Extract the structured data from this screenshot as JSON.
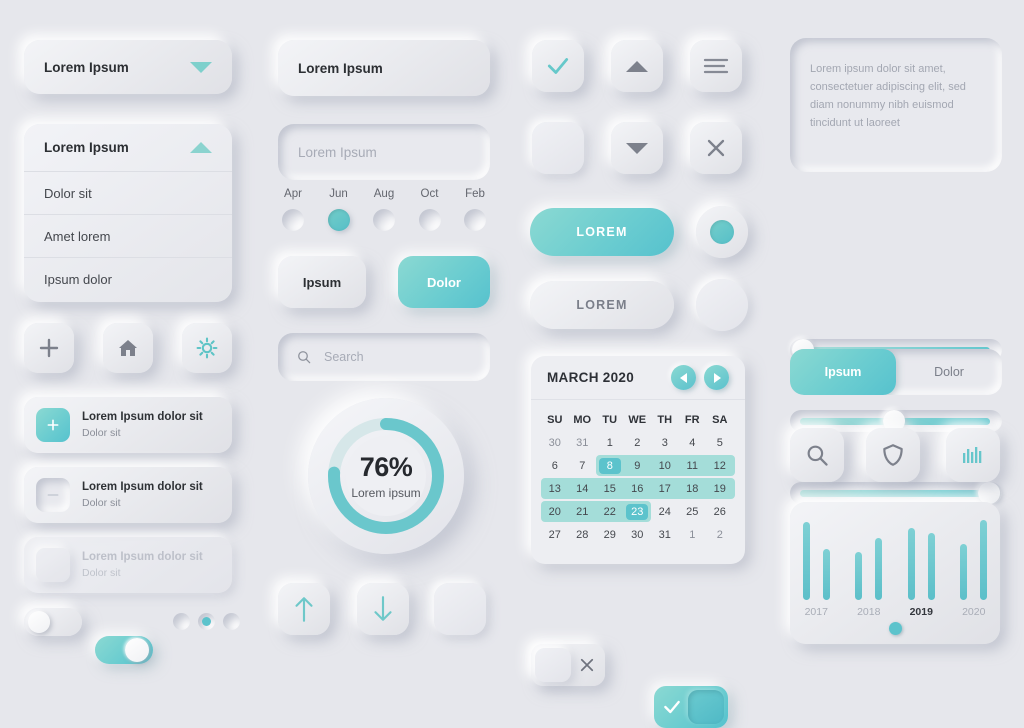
{
  "theme": {
    "background": "#e6e7ec",
    "accent": "#5cc3cc",
    "accent_light": "#8bd9d2",
    "accent_band": "#a4ddd9",
    "text_dark": "#2c2f33",
    "text_mid": "#7b7f8a",
    "text_light": "#b4b8c2"
  },
  "column1": {
    "dropdown_closed": {
      "label": "Lorem Ipsum",
      "icon": "chevron-down-icon"
    },
    "dropdown_open": {
      "label": "Lorem Ipsum",
      "icon": "chevron-up-icon",
      "options": [
        "Dolor sit",
        "Amet lorem",
        "Ipsum dolor"
      ]
    },
    "icon_buttons": [
      {
        "name": "plus-icon",
        "glyph": "+"
      },
      {
        "name": "home-icon",
        "glyph": "home"
      },
      {
        "name": "gear-icon",
        "glyph": "gear"
      }
    ],
    "list_items": [
      {
        "title": "Lorem Ipsum dolor sit",
        "subtitle": "Dolor sit",
        "icon": "plus-icon",
        "state": "active"
      },
      {
        "title": "Lorem Ipsum dolor sit",
        "subtitle": "Dolor sit",
        "icon": "minus-icon",
        "state": "normal"
      },
      {
        "title": "Lorem Ipsum dolor sit",
        "subtitle": "Dolor sit",
        "icon": "blank-icon",
        "state": "disabled"
      }
    ],
    "toggles": [
      {
        "name": "toggle-off",
        "state": "off"
      },
      {
        "name": "toggle-on",
        "state": "on"
      }
    ],
    "radio_dots": [
      {
        "state": "off"
      },
      {
        "state": "on"
      },
      {
        "state": "off"
      }
    ]
  },
  "column2": {
    "input_filled": {
      "value": "Lorem Ipsum"
    },
    "input_empty": {
      "value": "",
      "placeholder": "Lorem Ipsum"
    },
    "month_radios": {
      "options": [
        "Apr",
        "Jun",
        "Aug",
        "Oct",
        "Feb"
      ],
      "selected": "Jun"
    },
    "segment_buttons": [
      {
        "label": "Ipsum",
        "state": "inactive"
      },
      {
        "label": "Dolor",
        "state": "active"
      }
    ],
    "search": {
      "placeholder": "Search",
      "value": "",
      "icon": "search-icon"
    },
    "progress": {
      "percent": "76%",
      "value": 76,
      "caption": "Lorem ipsum"
    },
    "arrow_buttons": [
      {
        "name": "arrow-up-icon"
      },
      {
        "name": "arrow-down-icon"
      },
      {
        "name": "blank-button"
      }
    ]
  },
  "column3": {
    "checkbox_row1": [
      {
        "name": "check-icon",
        "state": "checked"
      },
      {
        "name": "triangle-up-icon",
        "state": "normal"
      },
      {
        "name": "hamburger-icon",
        "state": "normal"
      }
    ],
    "checkbox_row2": [
      {
        "name": "empty-checkbox",
        "state": "unchecked"
      },
      {
        "name": "triangle-down-icon",
        "state": "normal"
      },
      {
        "name": "close-icon",
        "state": "normal"
      }
    ],
    "buttons": [
      {
        "label": "LOREM",
        "state": "active"
      },
      {
        "label": "LOREM",
        "state": "inactive"
      }
    ],
    "radio_large": [
      {
        "state": "on"
      },
      {
        "state": "off"
      }
    ],
    "calendar": {
      "title": "MARCH 2020",
      "prev_icon": "chevron-left-icon",
      "next_icon": "chevron-right-icon",
      "day_headers": [
        "SU",
        "MO",
        "TU",
        "WE",
        "TH",
        "FR",
        "SA"
      ],
      "weeks": [
        [
          {
            "d": "30",
            "m": true
          },
          {
            "d": "31",
            "m": true
          },
          {
            "d": "1"
          },
          {
            "d": "2"
          },
          {
            "d": "3"
          },
          {
            "d": "4"
          },
          {
            "d": "5"
          }
        ],
        [
          {
            "d": "6"
          },
          {
            "d": "7"
          },
          {
            "d": "8",
            "sel": true
          },
          {
            "d": "9",
            "hl": true
          },
          {
            "d": "10",
            "hl": true
          },
          {
            "d": "11",
            "hl": true
          },
          {
            "d": "12",
            "hl": true
          }
        ],
        [
          {
            "d": "13",
            "hl": true
          },
          {
            "d": "14",
            "hl": true
          },
          {
            "d": "15",
            "hl": true
          },
          {
            "d": "16",
            "hl": true
          },
          {
            "d": "17",
            "hl": true
          },
          {
            "d": "18",
            "hl": true
          },
          {
            "d": "19",
            "hl": true
          }
        ],
        [
          {
            "d": "20",
            "hl": true
          },
          {
            "d": "21",
            "hl": true
          },
          {
            "d": "22",
            "hl": true
          },
          {
            "d": "23",
            "sel": true
          },
          {
            "d": "24"
          },
          {
            "d": "25"
          },
          {
            "d": "26"
          }
        ],
        [
          {
            "d": "27"
          },
          {
            "d": "28"
          },
          {
            "d": "29"
          },
          {
            "d": "30"
          },
          {
            "d": "31"
          },
          {
            "d": "1",
            "m": true
          },
          {
            "d": "2",
            "m": true
          }
        ]
      ],
      "range_start": "8",
      "range_end": "23"
    },
    "switches": [
      {
        "name": "switch-off",
        "state": "off",
        "icon": "close-icon"
      },
      {
        "name": "switch-on",
        "state": "on",
        "icon": "check-icon"
      }
    ]
  },
  "column4": {
    "textarea": {
      "value": "Lorem ipsum dolor sit amet, consectetuer adipiscing elit, sed diam nonummy nibh euismod tincidunt ut laoreet"
    },
    "sliders": [
      {
        "name": "slider-min",
        "value": 2
      },
      {
        "name": "slider-mid",
        "value": 48
      },
      {
        "name": "slider-max",
        "value": 95
      }
    ],
    "tabs": [
      {
        "label": "Ipsum",
        "state": "active"
      },
      {
        "label": "Dolor",
        "state": "inactive"
      }
    ],
    "tool_buttons": [
      {
        "name": "search-icon"
      },
      {
        "name": "shield-icon"
      },
      {
        "name": "bar-chart-icon"
      }
    ],
    "chart_card": {
      "selected_year": "2019"
    }
  },
  "chart_data": {
    "type": "bar",
    "title": "",
    "xlabel": "",
    "ylabel": "",
    "categories": [
      "2017",
      "2018",
      "2019",
      "2020"
    ],
    "selected_category": "2019",
    "series": [
      {
        "name": "A",
        "values": [
          95,
          58,
          88,
          68
        ]
      },
      {
        "name": "B",
        "values": [
          62,
          75,
          82,
          98
        ]
      }
    ],
    "ylim": [
      0,
      100
    ],
    "grid": false,
    "legend": "none",
    "tick_labels": [
      "2017",
      "2018",
      "2019",
      "2020"
    ]
  }
}
